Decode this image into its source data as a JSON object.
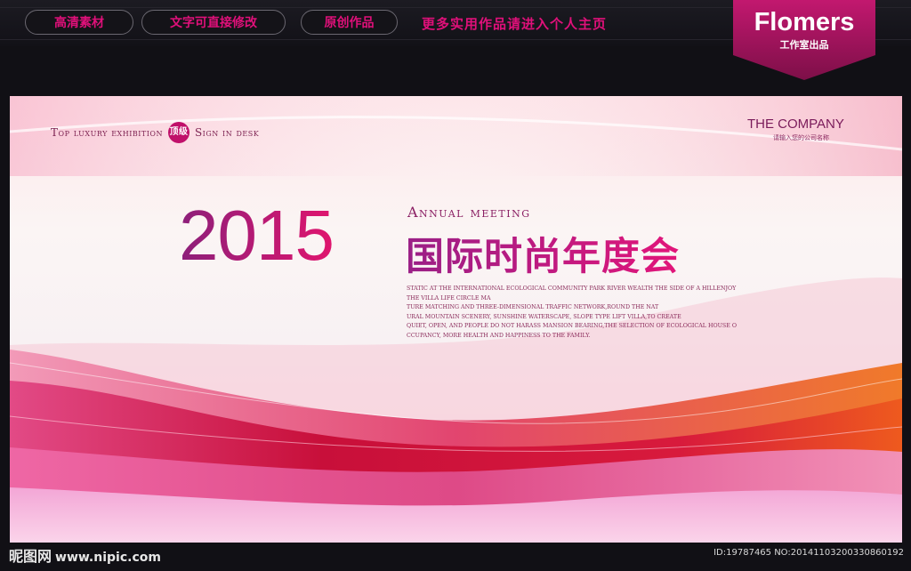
{
  "topbar": {
    "pills": [
      "高清素材",
      "文字可直接修改",
      "原创作品"
    ],
    "promo": "更多实用作品请进入个人主页",
    "brand": {
      "name": "Flomers",
      "subtitle": "工作室出品"
    }
  },
  "board": {
    "tagline_left": "Top luxury exhibition",
    "tagline_seal": "顶级",
    "tagline_right": "Sign in desk",
    "company": "THE COMPANY",
    "company_sub": "请输入您的公司名称",
    "year": "2015",
    "annual": "Annual meeting",
    "headline": "国际时尚年度会",
    "body_lines": [
      "STATIC AT THE INTERNATIONAL ECOLOGICAL COMMUNITY PARK RIVER WEALTH THE SIDE OF A HILLENJOY",
      "THE VILLA LIFE CIRCLE MA",
      "TURE MATCHING AND THREE-DIMENSIONAL TRAFFIC NETWORK,ROUND THE NAT",
      "URAL MOUNTAIN SCENERY, SUNSHINE WATERSCAPE, SLOPE TYPE LIFT VILLA,TO CREATE",
      "QUIET, OPEN, AND PEOPLE DO NOT HARASS MANSION BEARING,THE SELECTION OF ECOLOGICAL HOUSE O",
      "CCUPANCY, MORE HEALTH AND HAPPINESS TO THE FAMILY."
    ]
  },
  "footer": {
    "logo": "昵图网",
    "url": "www.nipic.com",
    "id": "ID:19787465 NO:20141103200330860192"
  },
  "colors": {
    "accent": "#e0107a",
    "deep": "#8c1f7a",
    "wave_red": "#d8123f",
    "wave_orange": "#f06a1e"
  }
}
